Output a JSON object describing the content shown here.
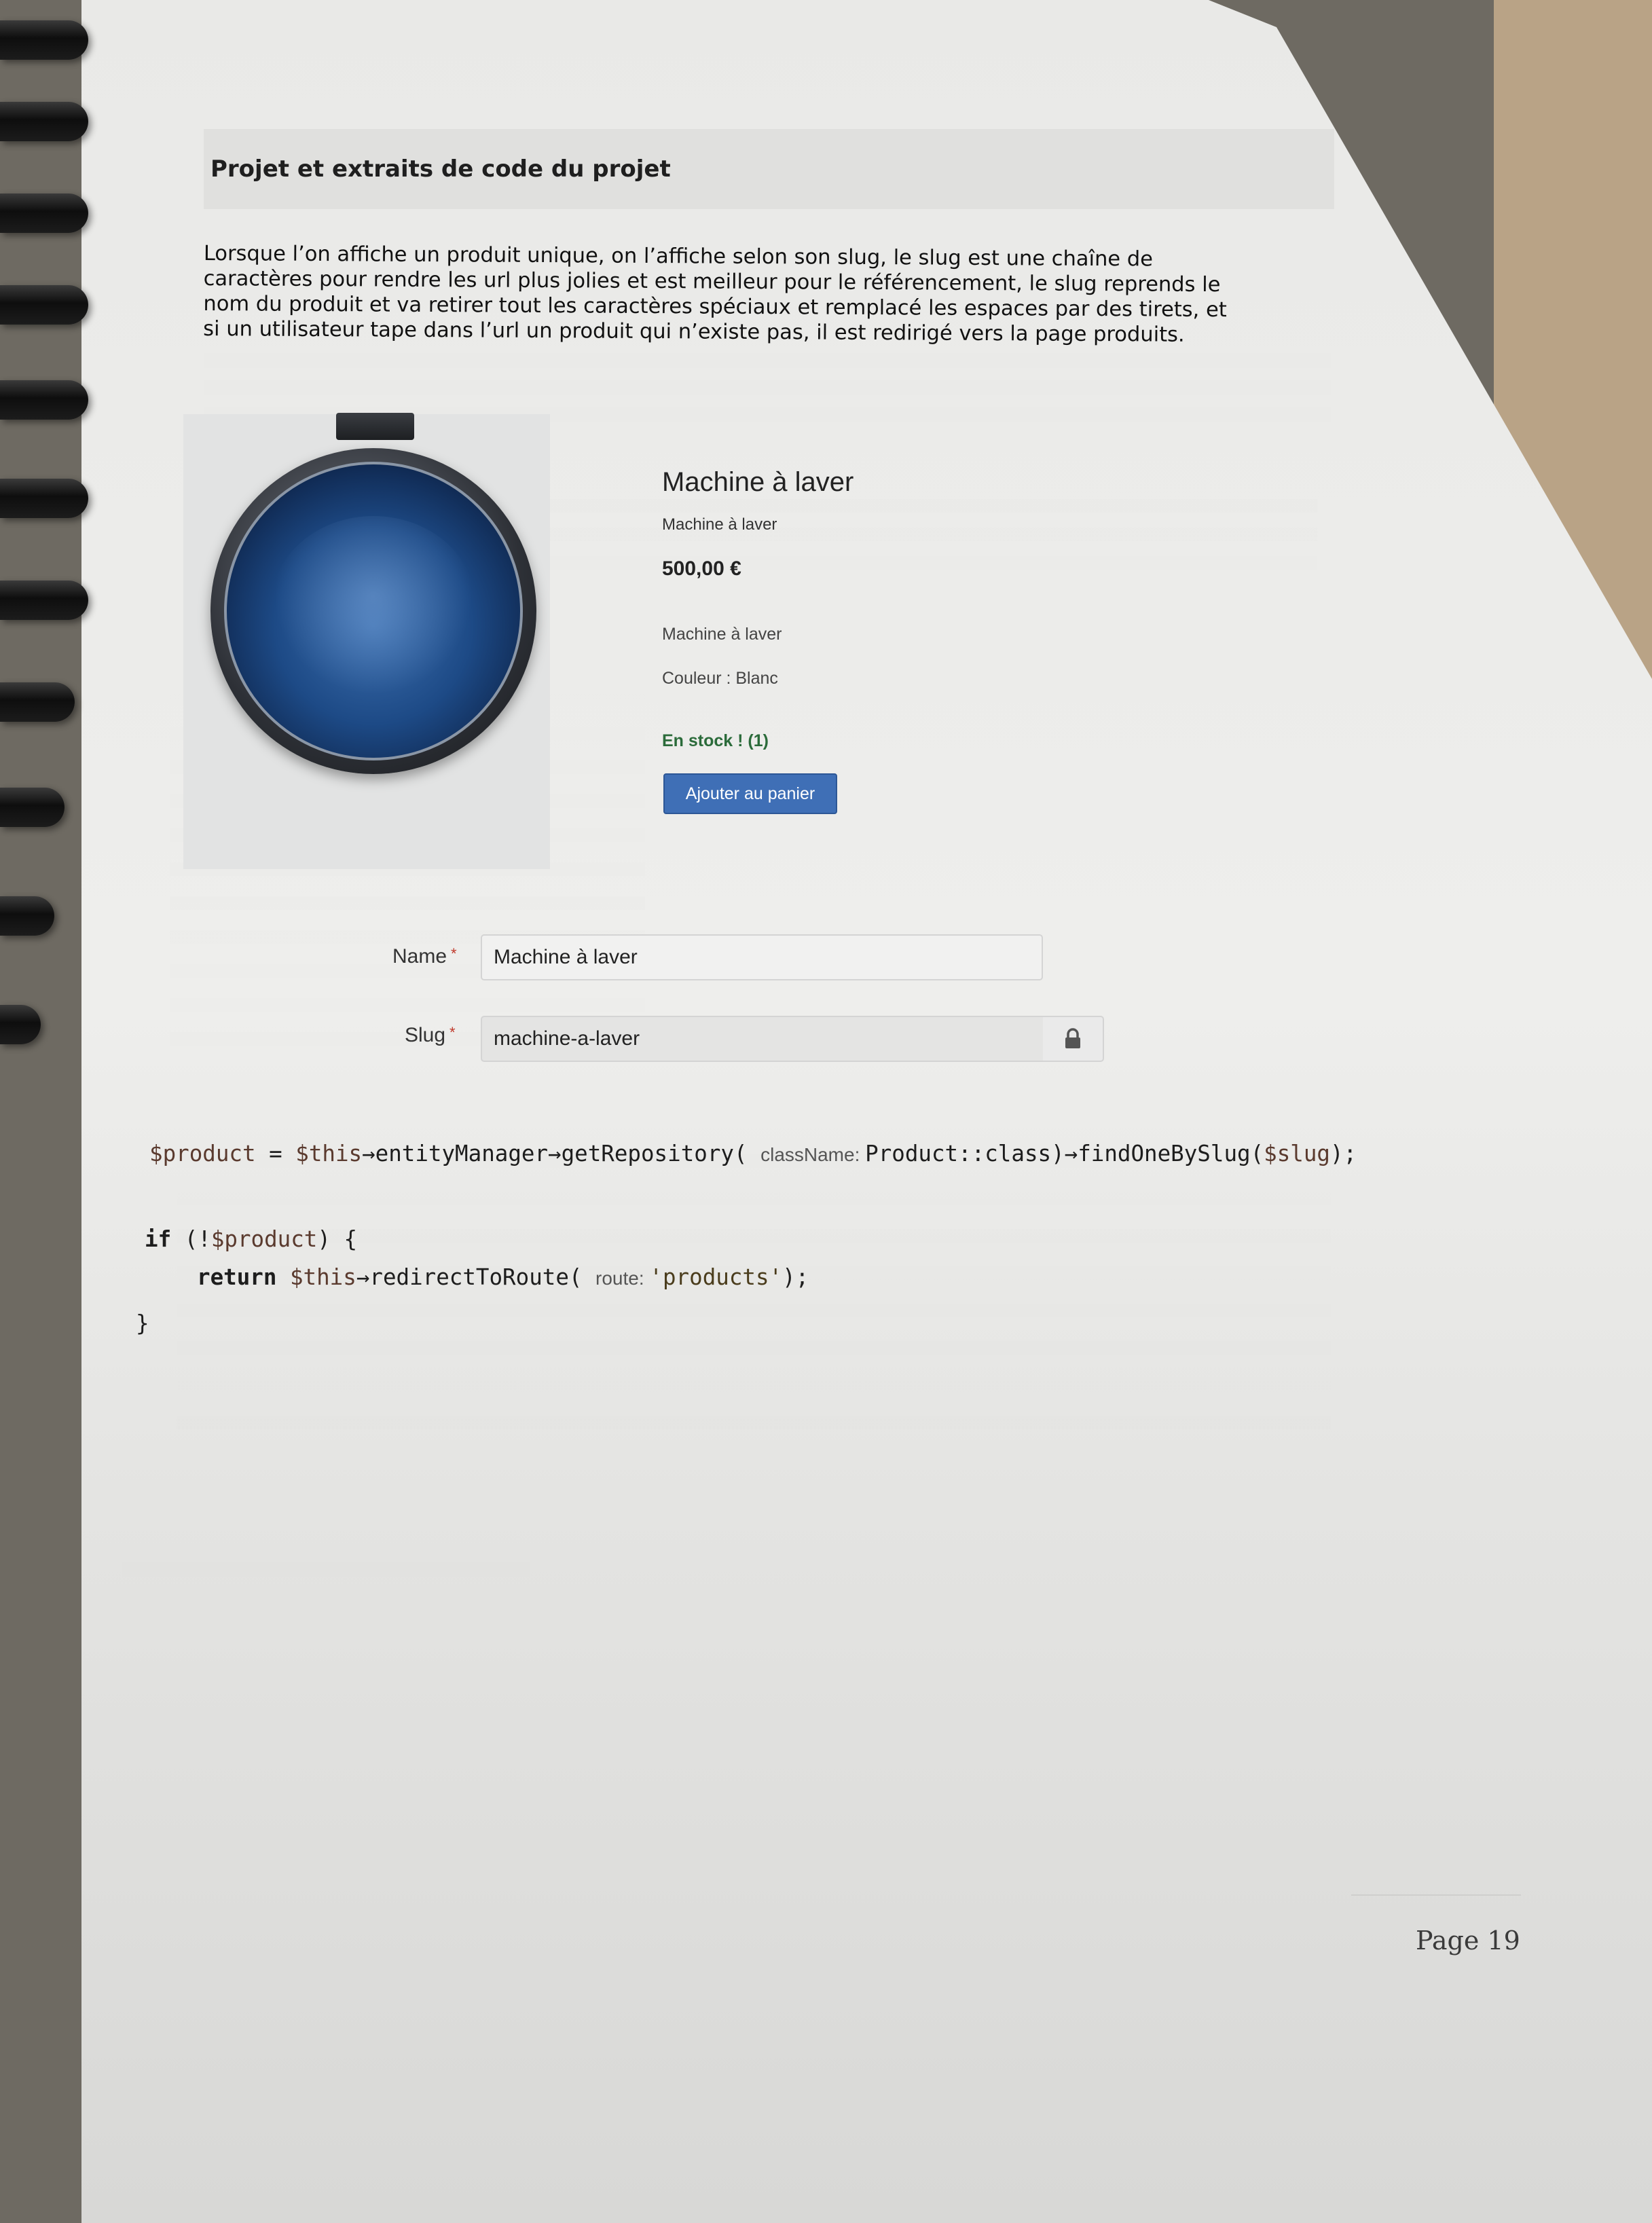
{
  "section_header": "Projet et extraits de code du projet",
  "intro_lines": [
    "Lorsque l’on affiche un produit unique, on l’affiche selon son slug, le slug est une chaîne de",
    "caractères pour rendre les url plus jolies et est meilleur pour le référencement, le slug reprends le",
    "nom du produit et va retirer tout les caractères spéciaux et remplacé les espaces par des tirets, et",
    "si un utilisateur tape dans l’url un produit qui n’existe pas, il est redirigé vers la page produits."
  ],
  "product": {
    "title": "Machine à laver",
    "subtitle": "Machine à laver",
    "price": "500,00 €",
    "description": "Machine à laver",
    "color": "Couleur : Blanc",
    "stock": "En stock ! (1)",
    "add_to_cart": "Ajouter au panier"
  },
  "form": {
    "name_label": "Name",
    "name_value": "Machine à laver",
    "slug_label": "Slug",
    "slug_value": "machine-a-laver",
    "required_mark": "*"
  },
  "code": {
    "line1_var": "$product",
    "line1_a": " = ",
    "line1_this": "$this",
    "line1_b": "→entityManager→getRepository( ",
    "line1_hint": "className: ",
    "line1_c": "Product::class)→findOneBySlug(",
    "line1_slug": "$slug",
    "line1_d": ");",
    "line2_kw": "if",
    "line2_a": " (!",
    "line2_var": "$product",
    "line2_b": ") {",
    "line3_kw": "return",
    "line3_a": " ",
    "line3_this": "$this",
    "line3_b": "→redirectToRoute( ",
    "line3_hint": "route: ",
    "line3_str": "'products'",
    "line3_c": ");",
    "line4": "}"
  },
  "page_number": "Page 19"
}
